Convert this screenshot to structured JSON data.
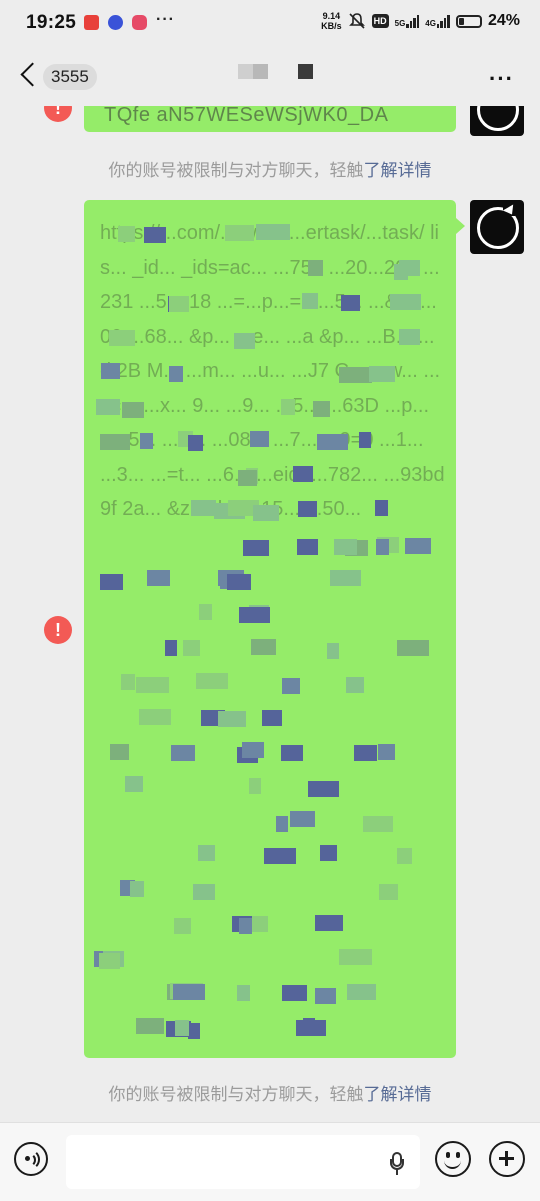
{
  "status_bar": {
    "time": "19:25",
    "net_speed_value": "9.14",
    "net_speed_unit": "KB/s",
    "hd_label": "HD",
    "signal1_label": "5G",
    "signal2_label": "4G",
    "battery_percent": "24%"
  },
  "header": {
    "unread_count": "3555",
    "more_label": "···"
  },
  "messages": {
    "top_bubble_text": "TQfe aN57WESeWSjWK0_DA",
    "main_bubble_text": "https://...com/... wx... ...ertask/...task/ lis... _id... _ids=ac... ...752 ...20...201 ...231 ...5 ...18 ...=...p...=0 ...5... ...&... ...00 ...68... &p... ...e... ...a &p... ...B... ...d 2B M... ...m... ...u... ...J7 C... ...w... ...uc... ...x... 9... ...9... ...5... ...63D ...p... ...=5... ...0... ...08... ...7... ...9=0 ...1... ...3... ...=t... ...6... ...eid=...782... ...93bd9f 2a... &z...id... ...15... ...50...",
    "system_notice_prefix": "你的账号被限制与对方聊天，轻触",
    "system_notice_link": "了解详情",
    "error_mark": "!"
  },
  "input_bar": {
    "placeholder": ""
  },
  "colors": {
    "bubble": "#95ec69",
    "link": "#576b95",
    "error": "#f35a55",
    "background": "#ededed"
  },
  "icons": [
    "back-icon",
    "more-icon",
    "retry-icon",
    "error-icon",
    "voice-icon",
    "mic-icon",
    "emoji-icon",
    "plus-icon"
  ]
}
